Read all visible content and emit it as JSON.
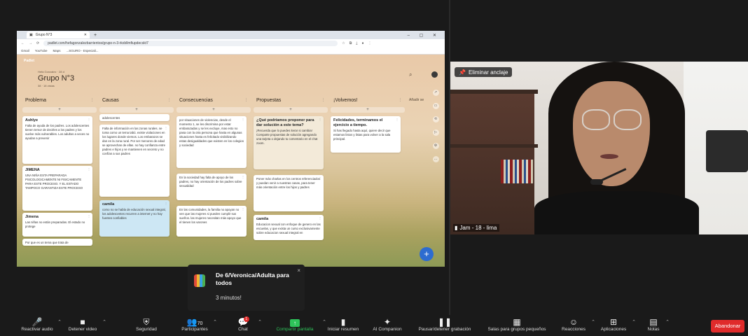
{
  "browser": {
    "tab_title": "Grupo N°3",
    "url": "padlet.com/hefagonzalezbarrientos/grupo-n-3-rkxbllmfiupdecskt7",
    "bookmarks": [
      "Gmail",
      "YouTube",
      "Maps",
      "...SGURO - Especiali..."
    ]
  },
  "padlet": {
    "brand": "Padlet",
    "owner": "Hefa Gonzalez · 28 d",
    "title": "Grupo N°3",
    "subtitle": "38 · 18 vistas",
    "columns": [
      {
        "title": "Problema",
        "cards": [
          {
            "heading": "Ashlye",
            "body": "Falta de ayuda de los padres. Los adolescentes tienen temor de decirles a los padres y los vuelve más vulnerables. Los adultos a veces no ayudan a prevenir"
          },
          {
            "heading": "JIMENA",
            "body": "UNA NIÑA ESTA PREPARADA PSICOLOGICAMENTE NI FISICAMENTE PARA ESTE PROCESO. Y EL ESTADO TAMPOCO GARANTIZA ESTE PROCESO"
          },
          {
            "heading": "Jimena",
            "body": "Las niñas no están preparadas. El estado no protege"
          },
          {
            "heading": "",
            "body": "Por que es un tema que trata de"
          }
        ]
      },
      {
        "title": "Causas",
        "cards": [
          {
            "heading": "",
            "body": "adolescentes"
          },
          {
            "heading": "",
            "body": "Falta de información en las zonas rurales. se toma como un tema tabú. existe violaciones en los lugares donde viemos. Los embarazos se dan en la zona rural. Por ser menores de edad se aprovechan de ellas. no hay confianza entre padres e hijos y se mantienen en secreto y no confían a sus padres"
          },
          {
            "heading": "camila",
            "body": "como no se habla de educación sexual integral, los adolescentes recurren a internet y no hay fuentes confiables"
          }
        ]
      },
      {
        "title": "Consecuencias",
        "cards": [
          {
            "heading": "",
            "body": "por situaciones de violencias, desde el momento 1, se les discrimina por estar embarazadas y se les excluye, mas esto no pasa con la otra persona que hasta en algunas situaciones hasta es felicitado visibilizando estas desigualdades que existen en los colegios y sociedad"
          },
          {
            "heading": "",
            "body": "En la sociedad hay falta de apoyo de los padres, no hay orientación de los padres sobre sexualidad"
          },
          {
            "heading": "",
            "body": "En las comunidades, la familia no apoyan no ven que las mujeres si pueden cumplir sus sueños. las mujeres necesitan más apoyo que el tienen los varones"
          }
        ]
      },
      {
        "title": "Propuestas",
        "cards": [
          {
            "heading": "¿Qué podríamos proponer para dar solución a este tema?",
            "body": "¡Recuerda que lo puedes iterar si cambia! Comparte propuestas de solución agregando una tarjeta o dejando tu comentario en el chat zoom."
          },
          {
            "heading": "",
            "body": "Poner más charlas en los centros referenciados y puedan venir a nuestras casas, para tener más orientación entre los hijos y padres"
          },
          {
            "heading": "camila",
            "body": "Educacion sexual con enfoque de genero en las escuelas, y que exista un curso exclusivamente sobre educacion sexual integral en"
          }
        ]
      },
      {
        "title": "¡Volvemos!",
        "cards": [
          {
            "heading": "Felicidades, terminamos el ejercicio a tiempo.",
            "body": "Si has llegado hasta aquí, quiere decir que estamos listos y listas para volver a la sala principal."
          }
        ]
      }
    ],
    "add_section": "Añadir se",
    "fab": "+"
  },
  "camera": {
    "unpin_label": "Eliminar anclaje",
    "participant_name": "Jam - 18 - lima"
  },
  "notification": {
    "title": "De 6/Veronica/Adulta para todos",
    "subtitle": "3 minutos!",
    "close": "×"
  },
  "toolbar": {
    "items": [
      {
        "label": "Reactivar audio",
        "icon": "🎤"
      },
      {
        "label": "Detener video",
        "icon": "■"
      },
      {
        "label": "Seguridad",
        "icon": "⛨"
      },
      {
        "label": "Participantes",
        "icon": "👥",
        "count": "70"
      },
      {
        "label": "Chat",
        "icon": "💬",
        "badge": "1"
      },
      {
        "label": "Compartir pantalla",
        "icon": "↑"
      },
      {
        "label": "Iniciar resumen",
        "icon": "▮"
      },
      {
        "label": "AI Companion",
        "icon": "✦"
      },
      {
        "label": "Pausar/detener grabación",
        "icon": "❚❚"
      },
      {
        "label": "Salas para grupos pequeños",
        "icon": "▦"
      },
      {
        "label": "Reacciones",
        "icon": "☺"
      },
      {
        "label": "Aplicaciones",
        "icon": "⊞"
      },
      {
        "label": "Notas",
        "icon": "▤"
      }
    ],
    "leave_label": "Abandonar"
  }
}
